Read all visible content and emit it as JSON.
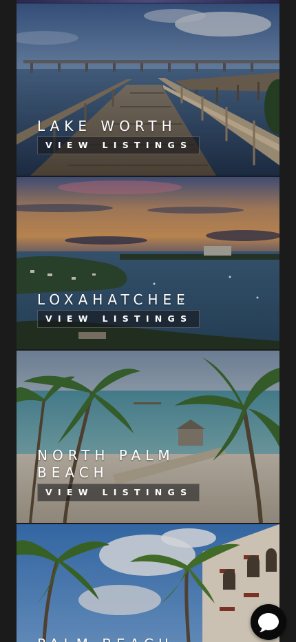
{
  "button_label": "VIEW LISTINGS",
  "cards": [
    {
      "title": "LAKE WORTH",
      "button": "VIEW LISTINGS"
    },
    {
      "title": "LOXAHATCHEE",
      "button": "VIEW LISTINGS"
    },
    {
      "title_lines": [
        "NORTH PALM",
        "BEACH"
      ],
      "button": "VIEW LISTINGS"
    },
    {
      "title": "PALM BEACH"
    }
  ],
  "chat": {
    "icon": "chat-bubble-icon"
  },
  "colors": {
    "background": "#1b1b1b",
    "overlay": "#14141a",
    "text": "#ffffff",
    "chat": "#0a0a0a"
  }
}
